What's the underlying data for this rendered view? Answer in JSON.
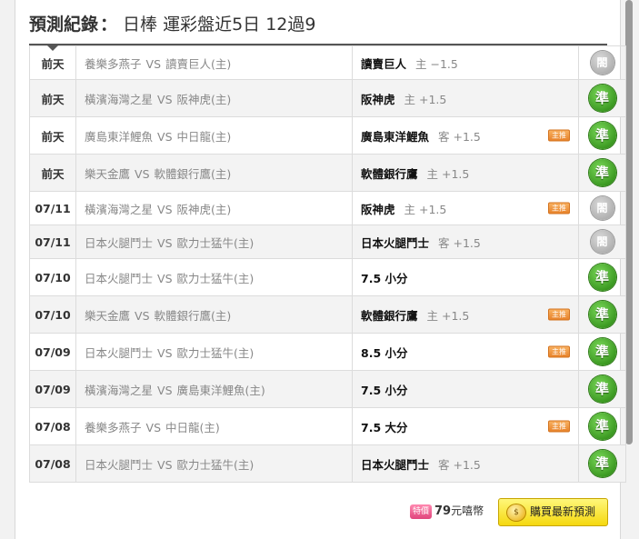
{
  "header": {
    "label": "預測紀錄",
    "separator": "：",
    "subtitle": "日棒 運彩盤近5日 12過9"
  },
  "rows": [
    {
      "date": "前天",
      "home": "養樂多燕子",
      "vs": "VS",
      "away": "讀賣巨人(主)",
      "pick": "讀賣巨人",
      "spread": "主 −1.5",
      "badge": "",
      "result": "閤",
      "result_type": "pending"
    },
    {
      "date": "前天",
      "home": "橫濱海灣之星",
      "vs": "VS",
      "away": "阪神虎(主)",
      "pick": "阪神虎",
      "spread": "主 +1.5",
      "badge": "",
      "result": "準",
      "result_type": "hit"
    },
    {
      "date": "前天",
      "home": "廣島東洋鯉魚",
      "vs": "VS",
      "away": "中日龍(主)",
      "pick": "廣島東洋鯉魚",
      "spread": "客 +1.5",
      "badge": "主推",
      "result": "準",
      "result_type": "hit"
    },
    {
      "date": "前天",
      "home": "樂天金鷹",
      "vs": "VS",
      "away": "軟體銀行鷹(主)",
      "pick": "軟體銀行鷹",
      "spread": "主 +1.5",
      "badge": "",
      "result": "準",
      "result_type": "hit"
    },
    {
      "date": "07/11",
      "home": "橫濱海灣之星",
      "vs": "VS",
      "away": "阪神虎(主)",
      "pick": "阪神虎",
      "spread": "主 +1.5",
      "badge": "主推",
      "result": "閤",
      "result_type": "pending"
    },
    {
      "date": "07/11",
      "home": "日本火腿鬥士",
      "vs": "VS",
      "away": "歐力士猛牛(主)",
      "pick": "日本火腿鬥士",
      "spread": "客 +1.5",
      "badge": "",
      "result": "閤",
      "result_type": "pending"
    },
    {
      "date": "07/10",
      "home": "日本火腿鬥士",
      "vs": "VS",
      "away": "歐力士猛牛(主)",
      "pick": "7.5 小分",
      "spread": "",
      "badge": "",
      "result": "準",
      "result_type": "hit"
    },
    {
      "date": "07/10",
      "home": "樂天金鷹",
      "vs": "VS",
      "away": "軟體銀行鷹(主)",
      "pick": "軟體銀行鷹",
      "spread": "主 +1.5",
      "badge": "主推",
      "result": "準",
      "result_type": "hit"
    },
    {
      "date": "07/09",
      "home": "日本火腿鬥士",
      "vs": "VS",
      "away": "歐力士猛牛(主)",
      "pick": "8.5 小分",
      "spread": "",
      "badge": "主推",
      "result": "準",
      "result_type": "hit"
    },
    {
      "date": "07/09",
      "home": "橫濱海灣之星",
      "vs": "VS",
      "away": "廣島東洋鯉魚(主)",
      "pick": "7.5 小分",
      "spread": "",
      "badge": "",
      "result": "準",
      "result_type": "hit"
    },
    {
      "date": "07/08",
      "home": "養樂多燕子",
      "vs": "VS",
      "away": "中日龍(主)",
      "pick": "7.5 大分",
      "spread": "",
      "badge": "主推",
      "result": "準",
      "result_type": "hit"
    },
    {
      "date": "07/08",
      "home": "日本火腿鬥士",
      "vs": "VS",
      "away": "歐力士猛牛(主)",
      "pick": "日本火腿鬥士",
      "spread": "客 +1.5",
      "badge": "",
      "result": "準",
      "result_type": "hit"
    }
  ],
  "footer": {
    "coin_tag": "特價",
    "price": "79",
    "unit": "元嘻幣",
    "buy_icon": "coin-icon",
    "buy_label": "購買最新預測"
  },
  "colors": {
    "hit": "#3c9a22",
    "pending": "#b1b1b1",
    "badge": "#e8832a",
    "button": "#f5d80f"
  }
}
